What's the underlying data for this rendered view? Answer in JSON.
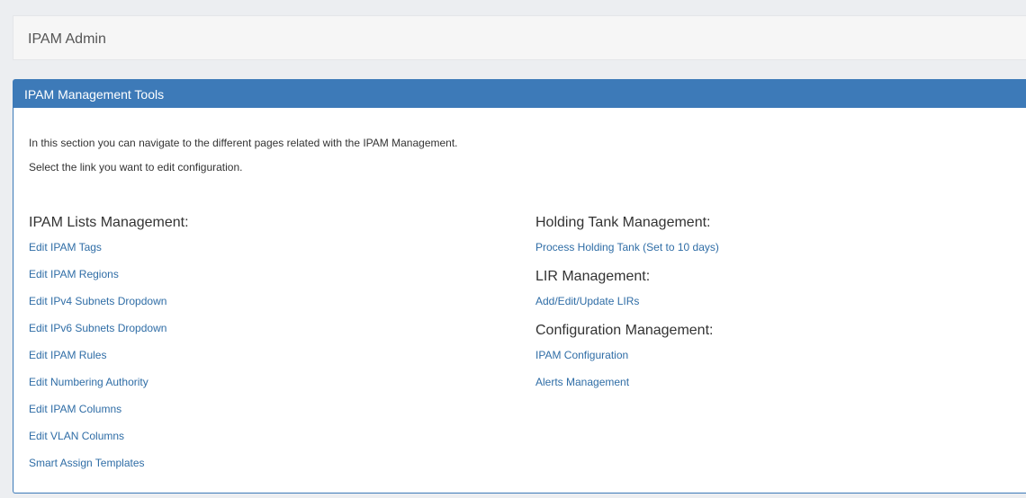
{
  "breadcrumb": {
    "title": "IPAM Admin"
  },
  "panel": {
    "title": "IPAM Management Tools",
    "intro_line_1": "In this section you can navigate to the different pages related with the IPAM Management.",
    "intro_line_2": "Select the link you want to edit configuration."
  },
  "lists_management": {
    "heading": "IPAM Lists Management:",
    "links": [
      "Edit IPAM Tags",
      "Edit IPAM Regions",
      "Edit IPv4 Subnets Dropdown",
      "Edit IPv6 Subnets Dropdown",
      "Edit IPAM Rules",
      "Edit Numbering Authority",
      "Edit IPAM Columns",
      "Edit VLAN Columns",
      "Smart Assign Templates"
    ]
  },
  "holding_tank": {
    "heading": "Holding Tank Management:",
    "links": [
      "Process Holding Tank (Set to 10 days)"
    ]
  },
  "lir_management": {
    "heading": "LIR Management:",
    "links": [
      "Add/Edit/Update LIRs"
    ]
  },
  "configuration_management": {
    "heading": "Configuration Management:",
    "links": [
      "IPAM Configuration",
      "Alerts Management"
    ]
  },
  "colors": {
    "accent": "#3d7ab8",
    "link": "#2f6da6",
    "background": "#eceef1"
  }
}
